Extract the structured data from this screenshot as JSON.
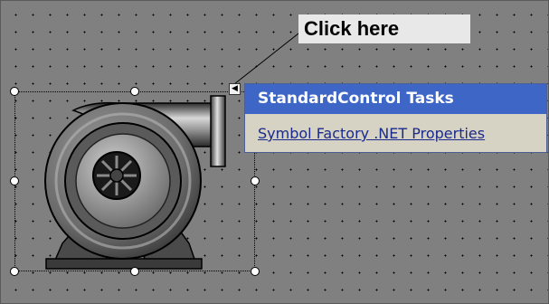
{
  "callout": {
    "text": "Click here"
  },
  "tasks_panel": {
    "title": "StandardControl Tasks",
    "link": "Symbol Factory .NET Properties"
  },
  "colors": {
    "canvas": "#808080",
    "header": "#3d66c6",
    "panel": "#d6d3c4",
    "link": "#1a2a8a"
  },
  "icons": {
    "smart_tag": "left-arrow-icon",
    "symbol": "pump-icon"
  }
}
